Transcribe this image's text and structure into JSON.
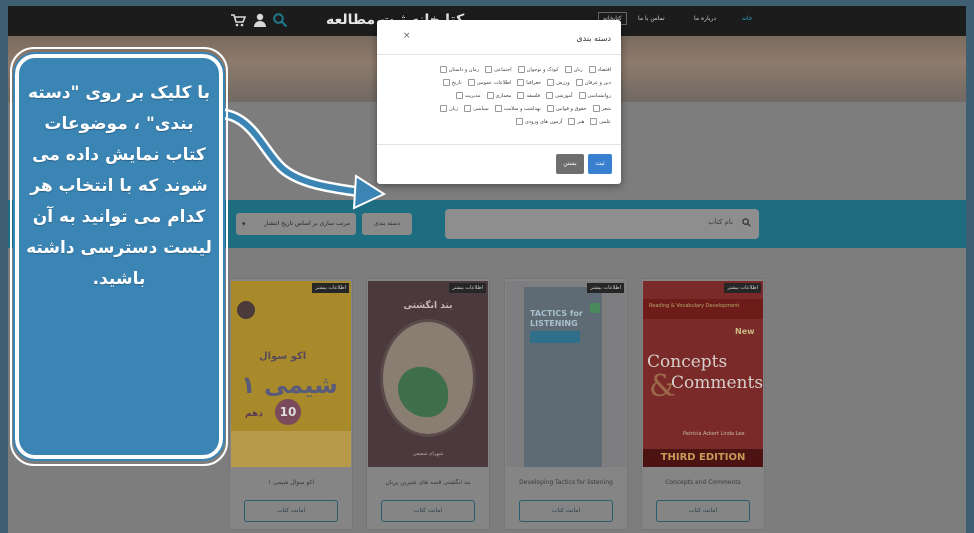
{
  "header": {
    "brand": "کتابخانه ثبت مطالعه",
    "nav": [
      "خانه",
      "درباره ما",
      "تماس با ما",
      "کتابخانه"
    ]
  },
  "search": {
    "placeholder": "نام کتاب",
    "category_button": "دسته بندی",
    "sort_label": "مرتب سازی بر اساس تاریخ انتشار"
  },
  "modal": {
    "title": "دسته بندی",
    "close": "×",
    "rows": [
      [
        "اقتصاد",
        "زنان",
        "کودک و نوجوان",
        "اجتماعی",
        "رمان و داستان"
      ],
      [
        "دین و عرفان",
        "ورزش",
        "جغرافیا",
        "اطلاعات عمومی",
        "تاریخ"
      ],
      [
        "روانشناسی",
        "آموزشی",
        "فلسفه",
        "معماری",
        "مدیریت"
      ],
      [
        "شعر",
        "حقوق و قوانین",
        "بهداشت و سلامت",
        "سیاسی",
        "زبان"
      ],
      [
        "علمی",
        "هنر",
        "آزمون های ورودی"
      ]
    ],
    "submit": "ثبت",
    "cancel": "بستن"
  },
  "books": [
    {
      "badge": "اطلاعات بیشتر",
      "title": "اکو سوال شیمی ۱",
      "borrow": "امانت کتاب",
      "cover_big": "شیمی ۱",
      "cover_mid": "اکو سوال",
      "cover_low": "دهم",
      "cover_num": "10"
    },
    {
      "badge": "اطلاعات بیشتر",
      "title": "بند انگشتی قصه های شیرین پریان",
      "borrow": "امانت کتاب",
      "cover_title": "بند انگشتی",
      "cover_author": "شهرام شفیعی"
    },
    {
      "badge": "اطلاعات بیشتر",
      "title": "Developing Tactics for listening",
      "borrow": "امانت کتاب",
      "cover_title": "TACTICS for LISTENING"
    },
    {
      "badge": "اطلاعات بیشتر",
      "title": "Concepts and Comments",
      "borrow": "امانت کتاب",
      "cover_top": "Reading & Vocabulary Development",
      "cover_new": "New",
      "cover_l1": "Concepts",
      "cover_l2": "Comments",
      "cover_amp": "&",
      "cover_authors": "Patricia Ackert  Linda Lee",
      "cover_edition": "THIRD EDITION"
    }
  ],
  "callout": {
    "text": "با کلیک بر روی \"دسته بندی\" ، موضوعات کتاب نمایش داده می شوند که با انتخاب هر کدام می توانید به آن لیست دسترسی داشته باشید."
  },
  "colors": {
    "band": "#1d6c80",
    "callout": "#3b85b5",
    "submit": "#3a7fd0"
  }
}
